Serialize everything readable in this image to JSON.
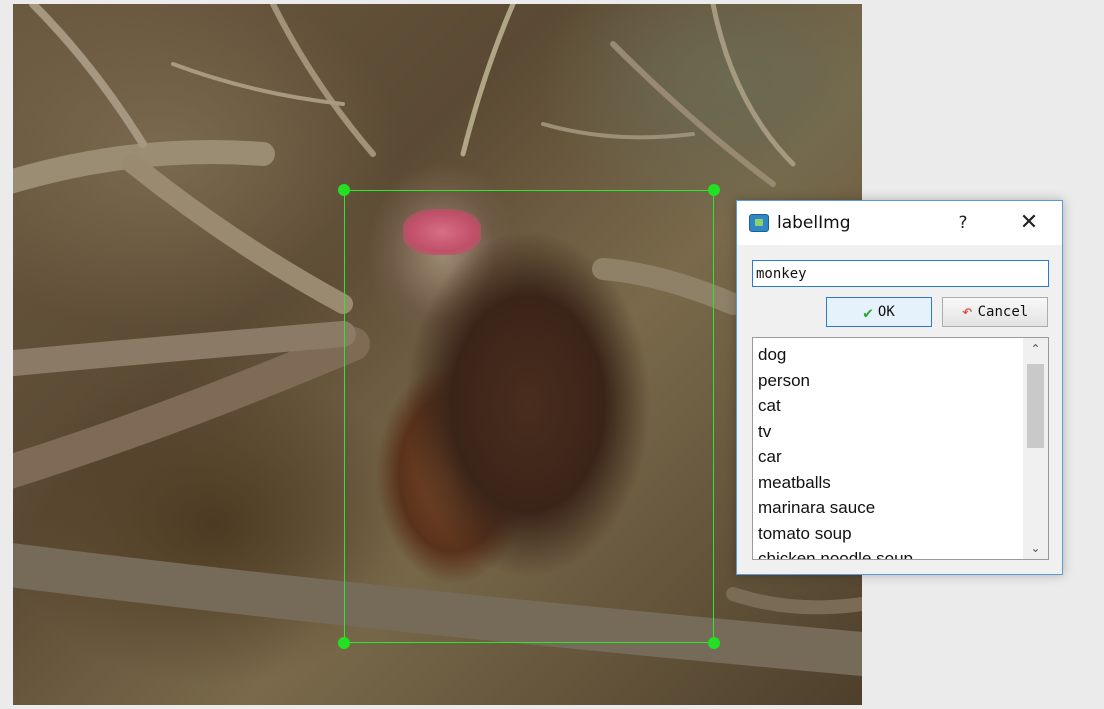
{
  "dialog": {
    "title": "labelImg",
    "help_label": "?",
    "close_label": "✕",
    "label_value": "monkey",
    "ok_label": "OK",
    "cancel_label": "Cancel",
    "label_list": [
      "dog",
      "person",
      "cat",
      "tv",
      "car",
      "meatballs",
      "marinara sauce",
      "tomato soup",
      "chicken noodle soup"
    ],
    "scroll_up": "⌃",
    "scroll_down": "⌄"
  },
  "annotation": {
    "box_color": "#2ee62e"
  },
  "icons": {
    "ok": "check-icon",
    "cancel": "undo-icon",
    "app": "labelimg-app-icon"
  }
}
